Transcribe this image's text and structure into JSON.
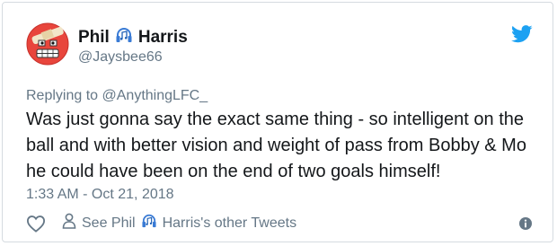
{
  "author": {
    "name_first": "Phil",
    "name_last": "Harris",
    "handle": "@Jaysbee66",
    "avatar_icon": "grinning-face-with-bandage-emoji",
    "name_icon": "headphones-music-icon"
  },
  "reply": {
    "prefix": "Replying to",
    "mention": "@AnythingLFC_"
  },
  "tweet": {
    "text": "Was just gonna say the exact same thing - so intelligent on the ball and with better vision and weight of pass from Bobby & Mo he could have been on the end of two goals himself!",
    "timestamp": "1:33 AM - Oct 21, 2018"
  },
  "actions": {
    "see_other_prefix": "See Phil",
    "see_other_suffix": "Harris's other Tweets"
  },
  "colors": {
    "twitter_blue": "#1da1f2",
    "secondary_text": "#657786",
    "primary_text": "#14171a"
  }
}
